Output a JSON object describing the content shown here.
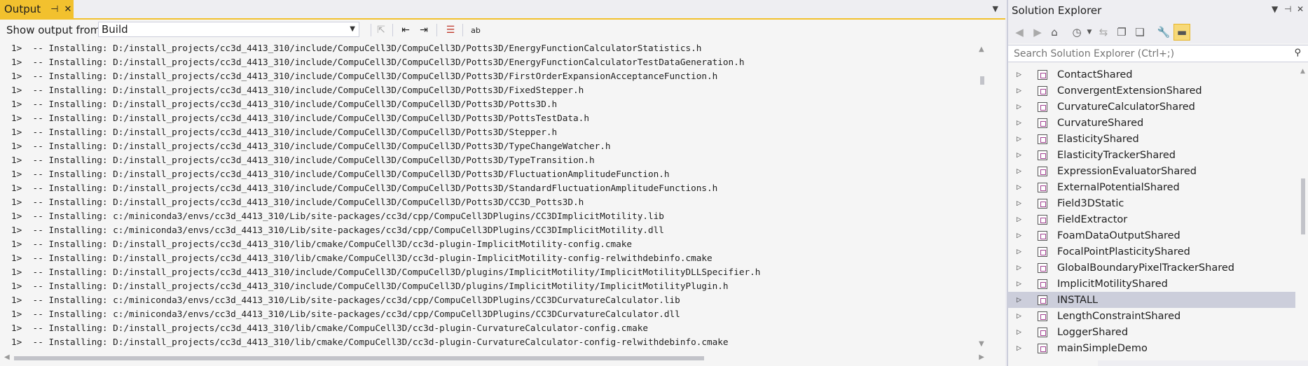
{
  "output": {
    "tab_label": "Output",
    "show_output_label": "Show output from:",
    "source_selected": "Build",
    "lines": [
      "1>  -- Installing: D:/install_projects/cc3d_4413_310/include/CompuCell3D/CompuCell3D/Potts3D/EnergyFunctionCalculatorStatistics.h",
      "1>  -- Installing: D:/install_projects/cc3d_4413_310/include/CompuCell3D/CompuCell3D/Potts3D/EnergyFunctionCalculatorTestDataGeneration.h",
      "1>  -- Installing: D:/install_projects/cc3d_4413_310/include/CompuCell3D/CompuCell3D/Potts3D/FirstOrderExpansionAcceptanceFunction.h",
      "1>  -- Installing: D:/install_projects/cc3d_4413_310/include/CompuCell3D/CompuCell3D/Potts3D/FixedStepper.h",
      "1>  -- Installing: D:/install_projects/cc3d_4413_310/include/CompuCell3D/CompuCell3D/Potts3D/Potts3D.h",
      "1>  -- Installing: D:/install_projects/cc3d_4413_310/include/CompuCell3D/CompuCell3D/Potts3D/PottsTestData.h",
      "1>  -- Installing: D:/install_projects/cc3d_4413_310/include/CompuCell3D/CompuCell3D/Potts3D/Stepper.h",
      "1>  -- Installing: D:/install_projects/cc3d_4413_310/include/CompuCell3D/CompuCell3D/Potts3D/TypeChangeWatcher.h",
      "1>  -- Installing: D:/install_projects/cc3d_4413_310/include/CompuCell3D/CompuCell3D/Potts3D/TypeTransition.h",
      "1>  -- Installing: D:/install_projects/cc3d_4413_310/include/CompuCell3D/CompuCell3D/Potts3D/FluctuationAmplitudeFunction.h",
      "1>  -- Installing: D:/install_projects/cc3d_4413_310/include/CompuCell3D/CompuCell3D/Potts3D/StandardFluctuationAmplitudeFunctions.h",
      "1>  -- Installing: D:/install_projects/cc3d_4413_310/include/CompuCell3D/CompuCell3D/Potts3D/CC3D_Potts3D.h",
      "1>  -- Installing: c:/miniconda3/envs/cc3d_4413_310/Lib/site-packages/cc3d/cpp/CompuCell3DPlugins/CC3DImplicitMotility.lib",
      "1>  -- Installing: c:/miniconda3/envs/cc3d_4413_310/Lib/site-packages/cc3d/cpp/CompuCell3DPlugins/CC3DImplicitMotility.dll",
      "1>  -- Installing: D:/install_projects/cc3d_4413_310/lib/cmake/CompuCell3D/cc3d-plugin-ImplicitMotility-config.cmake",
      "1>  -- Installing: D:/install_projects/cc3d_4413_310/lib/cmake/CompuCell3D/cc3d-plugin-ImplicitMotility-config-relwithdebinfo.cmake",
      "1>  -- Installing: D:/install_projects/cc3d_4413_310/include/CompuCell3D/CompuCell3D/plugins/ImplicitMotility/ImplicitMotilityDLLSpecifier.h",
      "1>  -- Installing: D:/install_projects/cc3d_4413_310/include/CompuCell3D/CompuCell3D/plugins/ImplicitMotility/ImplicitMotilityPlugin.h",
      "1>  -- Installing: c:/miniconda3/envs/cc3d_4413_310/Lib/site-packages/cc3d/cpp/CompuCell3DPlugins/CC3DCurvatureCalculator.lib",
      "1>  -- Installing: c:/miniconda3/envs/cc3d_4413_310/Lib/site-packages/cc3d/cpp/CompuCell3DPlugins/CC3DCurvatureCalculator.dll",
      "1>  -- Installing: D:/install_projects/cc3d_4413_310/lib/cmake/CompuCell3D/cc3d-plugin-CurvatureCalculator-config.cmake",
      "1>  -- Installing: D:/install_projects/cc3d_4413_310/lib/cmake/CompuCell3D/cc3d-plugin-CurvatureCalculator-config-relwithdebinfo.cmake"
    ]
  },
  "solution_explorer": {
    "title": "Solution Explorer",
    "search_placeholder": "Search Solution Explorer (Ctrl+;)",
    "items": [
      {
        "label": "ContactShared",
        "selected": false
      },
      {
        "label": "ConvergentExtensionShared",
        "selected": false
      },
      {
        "label": "CurvatureCalculatorShared",
        "selected": false
      },
      {
        "label": "CurvatureShared",
        "selected": false
      },
      {
        "label": "ElasticityShared",
        "selected": false
      },
      {
        "label": "ElasticityTrackerShared",
        "selected": false
      },
      {
        "label": "ExpressionEvaluatorShared",
        "selected": false
      },
      {
        "label": "ExternalPotentialShared",
        "selected": false
      },
      {
        "label": "Field3DStatic",
        "selected": false
      },
      {
        "label": "FieldExtractor",
        "selected": false
      },
      {
        "label": "FoamDataOutputShared",
        "selected": false
      },
      {
        "label": "FocalPointPlasticityShared",
        "selected": false
      },
      {
        "label": "GlobalBoundaryPixelTrackerShared",
        "selected": false
      },
      {
        "label": "ImplicitMotilityShared",
        "selected": false
      },
      {
        "label": "INSTALL",
        "selected": true
      },
      {
        "label": "LengthConstraintShared",
        "selected": false
      },
      {
        "label": "LoggerShared",
        "selected": false
      },
      {
        "label": "mainSimpleDemo",
        "selected": false
      }
    ]
  },
  "colors": {
    "accent": "#f2c12e",
    "selection": "#cccedb"
  }
}
